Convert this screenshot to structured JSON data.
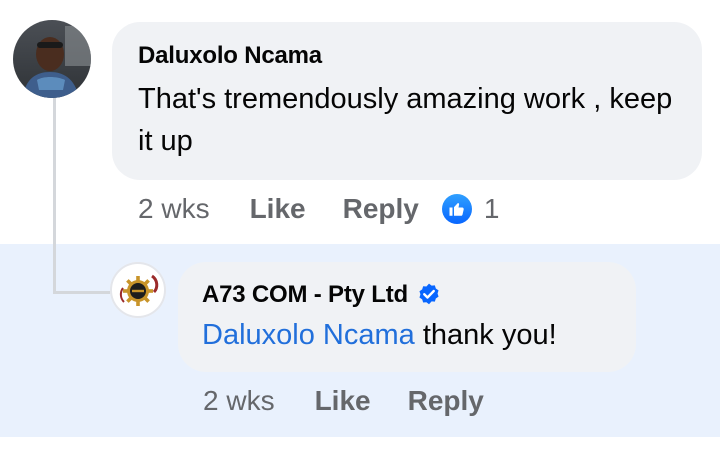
{
  "main_comment": {
    "author": "Daluxolo Ncama",
    "text": "That's tremendously amazing work , keep it up",
    "time": "2 wks",
    "like_label": "Like",
    "reply_label": "Reply",
    "reaction_count": "1"
  },
  "reply_comment": {
    "author": "A73 COM - Pty Ltd",
    "mention": "Daluxolo Ncama",
    "text": " thank you!",
    "time": "2 wks",
    "like_label": "Like",
    "reply_label": "Reply"
  },
  "icons": {
    "reaction": "thumbs-up-icon",
    "verified": "verified-badge-icon"
  },
  "colors": {
    "link_blue": "#216fdb",
    "reaction_blue": "#0866ff",
    "reply_highlight": "#e9f1fd",
    "bubble_gray": "#f0f2f5",
    "meta_gray": "#65676b"
  }
}
